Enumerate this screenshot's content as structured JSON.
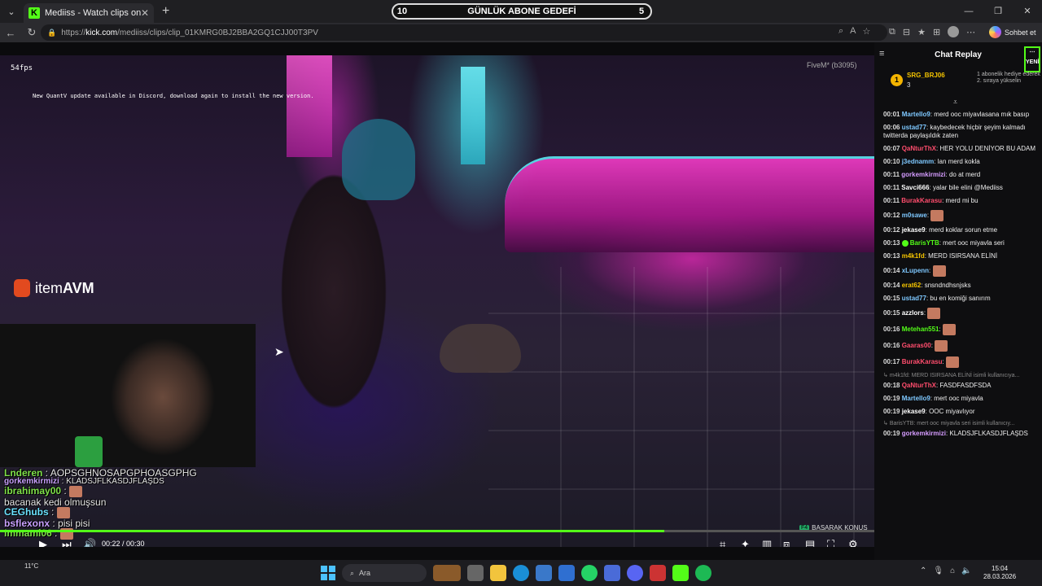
{
  "browser": {
    "tab_title": "Mediiss - Watch clips on Kick",
    "tab_favicon": "K",
    "url_prefix": "https://",
    "url_host": "kick.com",
    "url_path": "/mediiss/clips/clip_01KMRG0BJ2BBA2GQ1CJJ00T3PV",
    "copilot_label": "Sohbet et"
  },
  "goal_banner": {
    "left_number": "10",
    "title": "GÜNLÜK ABONE GEDEFİ",
    "right_number": "5"
  },
  "video": {
    "fps": "54fps",
    "notice": "New QuantV update available in Discord, download again to install the new version.",
    "fivem": "FiveM* (b3095)",
    "sponsor_prefix": "item",
    "sponsor_suffix": "AVM",
    "time": "00:22 / 00:30",
    "progress_fraction": 0.76,
    "talk_key": "F4",
    "talk_label": "BASARAK KONUŞ"
  },
  "overlay_chat": [
    {
      "user": "Lnderen",
      "text": "AOPSGHNOSAPGPHOASGPHG",
      "color": "#7fe04a",
      "big": true
    },
    {
      "user": "gorkemkirmizi",
      "text": "KLADSJFLKASDJFLAŞDS",
      "color": "#c9a0ff",
      "big": false
    },
    {
      "user": "ibrahimay00",
      "text": "",
      "color": "#7fe04a",
      "big": true,
      "emote": true
    },
    {
      "user": "",
      "text": "bacanak kedi olmuşsun",
      "color": "#ffffff",
      "big": true
    },
    {
      "user": "CEGhubs",
      "text": "",
      "color": "#6ae0ff",
      "big": true,
      "emote": true
    },
    {
      "user": "bsflexonx",
      "text": "pisi pisi",
      "color": "#c9a0ff",
      "big": true
    },
    {
      "user": "Immami06",
      "text": "",
      "color": "#7fe04a",
      "big": true,
      "emote": true
    }
  ],
  "chat": {
    "title": "Chat Replay",
    "new_label": "YENİ",
    "pinned": {
      "badge": "1",
      "user": "SRG_BRJ06",
      "count": "3",
      "message": "1 abonelik hediye ederek 2. sıraya yükselin"
    },
    "messages": [
      {
        "time": "00:01",
        "user": "Martello9",
        "color": "#7ec8ff",
        "text": "merd ooc miyavlasana mık basıp"
      },
      {
        "time": "00:06",
        "user": "ustad77",
        "color": "#7ec8ff",
        "text": "kaybedecek hiçbir şeyim kalmadı twitterda paylaşıldık zaten"
      },
      {
        "time": "00:07",
        "user": "QaNturThX",
        "color": "#ff4d6d",
        "text": "HER YOLU DENİYOR BU ADAM"
      },
      {
        "time": "00:10",
        "user": "j3ednamm",
        "color": "#7ec8ff",
        "text": "lan merd kokla"
      },
      {
        "time": "00:11",
        "user": "gorkemkirmizi",
        "color": "#d59cff",
        "text": "do at merd"
      },
      {
        "time": "00:11",
        "user": "Savci666",
        "color": "#ffffff",
        "text": "yalar bile elini @Mediiss"
      },
      {
        "time": "00:11",
        "user": "BurakKarasu",
        "color": "#ff4d6d",
        "text": "merd mi bu"
      },
      {
        "time": "00:12",
        "user": "m0sawe",
        "color": "#7ec8ff",
        "text": "",
        "emote": true
      },
      {
        "time": "00:12",
        "user": "jekase9",
        "color": "#ffffff",
        "text": "merd koklar sorun etme"
      },
      {
        "time": "00:13",
        "user": "BarisYTB",
        "color": "#53fc18",
        "text": "mert ooc miyavla seri",
        "verified": true
      },
      {
        "time": "00:13",
        "user": "m4k1fd",
        "color": "#f4c400",
        "text": "MERD ISIRSANA ELİNİ"
      },
      {
        "time": "00:14",
        "user": "xLupenn",
        "color": "#7ec8ff",
        "text": "",
        "emote": true
      },
      {
        "time": "00:14",
        "user": "erat62",
        "color": "#f4c400",
        "text": "snsndndhsnjsks"
      },
      {
        "time": "00:15",
        "user": "ustad77",
        "color": "#7ec8ff",
        "text": "bu en komiği sanırım"
      },
      {
        "time": "00:15",
        "user": "azzlors",
        "color": "#ffffff",
        "text": "",
        "emote": true
      },
      {
        "time": "00:16",
        "user": "Metehan551",
        "color": "#53fc18",
        "text": "",
        "emote": true
      },
      {
        "time": "00:16",
        "user": "Gaaras00",
        "color": "#ff4d6d",
        "text": "",
        "emote": true
      },
      {
        "time": "00:17",
        "user": "BurakKarasu",
        "color": "#ff4d6d",
        "text": "",
        "emote": true
      },
      {
        "reply": "m4k1fd: MERD ISIRSANA ELİNİ isimli kullanıcıya..."
      },
      {
        "time": "00:18",
        "user": "QaNturThX",
        "color": "#ff4d6d",
        "text": "FASDFASDFSDA"
      },
      {
        "time": "00:19",
        "user": "Martello9",
        "color": "#7ec8ff",
        "text": "mert ooc miyavla"
      },
      {
        "time": "00:19",
        "user": "jekase9",
        "color": "#ffffff",
        "text": "OOC miyavlıyor"
      },
      {
        "reply": "BarisYTB: mert ooc miyavla seri isimli kullanıcıy..."
      },
      {
        "time": "00:19",
        "user": "gorkemkirmizi",
        "color": "#d59cff",
        "text": "KLADSJFLKASDJFLAŞDS"
      }
    ]
  },
  "taskbar": {
    "weather": "11°C",
    "search_label": "Ara",
    "time": "15:04",
    "date": "28.03.2026"
  }
}
